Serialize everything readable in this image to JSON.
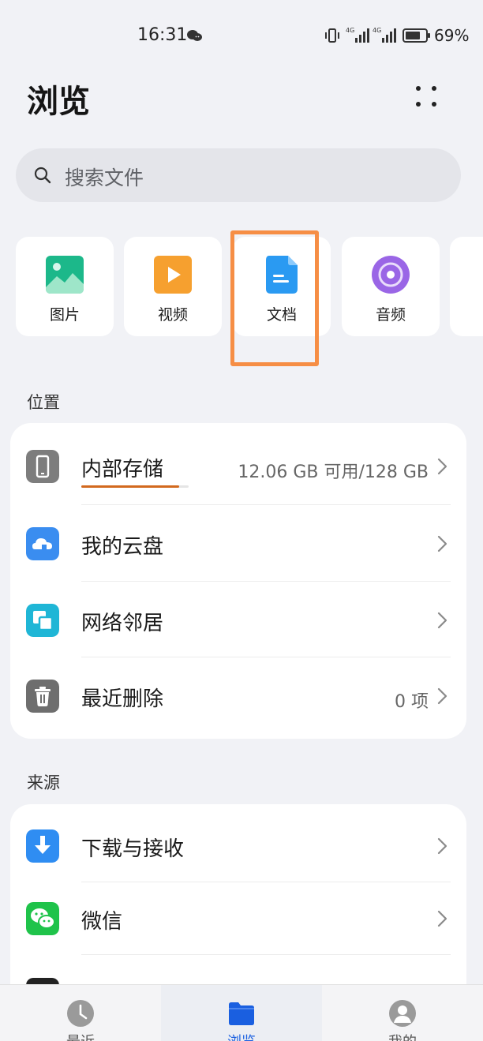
{
  "status_bar": {
    "time": "16:31",
    "battery": "69%",
    "icons": [
      "wechat-icon",
      "vibrate-icon",
      "signal-4g-icon",
      "signal-4g-icon",
      "battery-icon"
    ]
  },
  "header": {
    "title": "浏览",
    "more_icon": "more-dots-icon"
  },
  "search": {
    "placeholder": "搜索文件",
    "icon": "search-icon"
  },
  "categories": [
    {
      "label": "图片",
      "icon": "image-icon",
      "color": "#1cb88a"
    },
    {
      "label": "视频",
      "icon": "video-icon",
      "color": "#f6a02f"
    },
    {
      "label": "文档",
      "icon": "document-icon",
      "color": "#2a9af2",
      "highlighted": true
    },
    {
      "label": "音频",
      "icon": "audio-icon",
      "color": "#9a66e6"
    }
  ],
  "location": {
    "title": "位置",
    "items": [
      {
        "label": "内部存储",
        "value": "12.06 GB 可用/128 GB",
        "icon": "phone-storage-icon",
        "color": "#7d7d7d",
        "usage_fraction": 0.91
      },
      {
        "label": "我的云盘",
        "value": "",
        "icon": "cloud-icon",
        "color": "#3a8df0"
      },
      {
        "label": "网络邻居",
        "value": "",
        "icon": "network-icon",
        "color": "#1fb6d6"
      },
      {
        "label": "最近删除",
        "value": "0 项",
        "icon": "trash-icon",
        "color": "#6e6e6e"
      }
    ]
  },
  "source": {
    "title": "来源",
    "items": [
      {
        "label": "下载与接收",
        "value": "",
        "icon": "download-icon",
        "color": "#2f8df2"
      },
      {
        "label": "微信",
        "value": "",
        "icon": "wechat-icon",
        "color": "#1fc34a"
      }
    ]
  },
  "bottom_nav": [
    {
      "label": "最近",
      "icon": "clock-icon"
    },
    {
      "label": "浏览",
      "icon": "folder-icon",
      "active": true
    },
    {
      "label": "我的",
      "icon": "person-icon"
    }
  ],
  "colors": {
    "background": "#f1f2f6",
    "accent": "#1a5fe0",
    "highlight": "#f68e45"
  }
}
